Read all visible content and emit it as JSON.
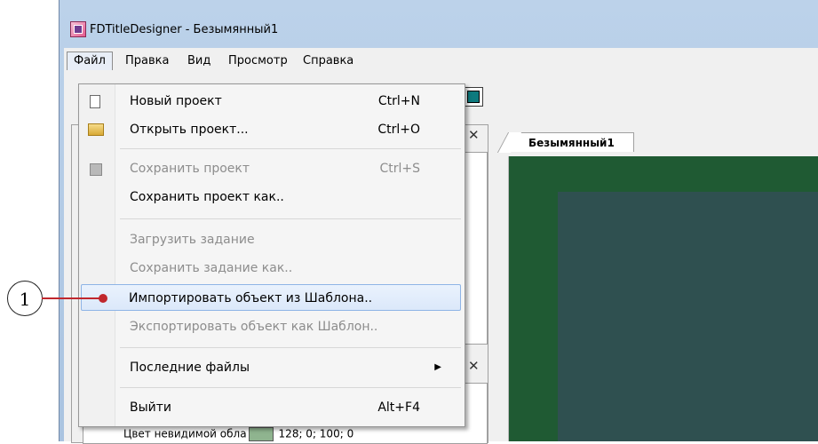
{
  "window": {
    "title": "FDTitleDesigner - Безымянный1"
  },
  "menubar": {
    "items": [
      "Файл",
      "Правка",
      "Вид",
      "Просмотр",
      "Справка"
    ]
  },
  "file_menu": {
    "items": [
      {
        "label": "Новый проект",
        "shortcut": "Ctrl+N",
        "icon": "new-document-icon",
        "enabled": true
      },
      {
        "label": "Открыть проект...",
        "shortcut": "Ctrl+O",
        "icon": "open-folder-icon",
        "enabled": true
      },
      {
        "label": "Сохранить проект",
        "shortcut": "Ctrl+S",
        "icon": "save-disk-icon",
        "enabled": false
      },
      {
        "label": "Сохранить проект как..",
        "shortcut": "",
        "enabled": true
      },
      {
        "label": "Загрузить задание",
        "shortcut": "",
        "enabled": false
      },
      {
        "label": "Сохранить задание как..",
        "shortcut": "",
        "enabled": false
      },
      {
        "label": "Импортировать объект из Шаблона..",
        "shortcut": "",
        "enabled": true,
        "highlighted": true
      },
      {
        "label": "Экспортировать объект как Шаблон..",
        "shortcut": "",
        "enabled": false
      },
      {
        "label": "Последние файлы",
        "shortcut": "",
        "enabled": true,
        "submenu": true
      },
      {
        "label": "Выйти",
        "shortcut": "Alt+F4",
        "enabled": true
      }
    ]
  },
  "document_tab": {
    "label": "Безымянный1"
  },
  "properties": {
    "invisible_color_label": "Цвет невидимой обла",
    "invisible_color_value": "128; 0; 100; 0"
  },
  "callout": {
    "number": "1"
  },
  "colors": {
    "canvas_outer": "#1f5a33",
    "canvas_inner": "#2f5050",
    "highlight": "#dbe8fa",
    "callout": "#c0272d"
  }
}
